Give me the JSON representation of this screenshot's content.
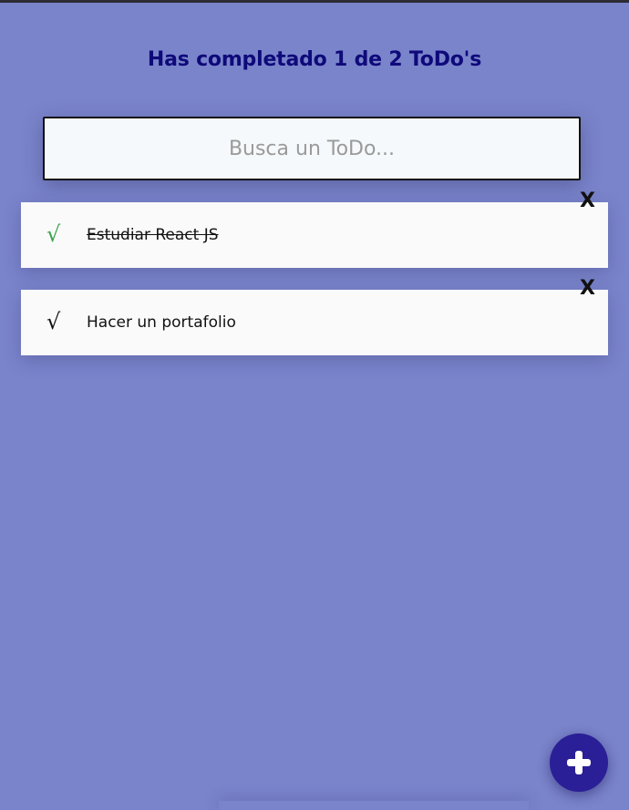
{
  "header": {
    "counter_text": "Has completado 1 de 2 ToDo's"
  },
  "search": {
    "placeholder": "Busca un ToDo...",
    "value": ""
  },
  "todos": [
    {
      "text": "Estudiar React JS",
      "completed": true,
      "check_glyph": "√",
      "delete_label": "X"
    },
    {
      "text": "Hacer un portafolio",
      "completed": false,
      "check_glyph": "√",
      "delete_label": "X"
    }
  ],
  "fab": {
    "icon": "plus-icon"
  },
  "colors": {
    "background": "#7a84cb",
    "title": "#0f0a7a",
    "check_done": "#3aa24a",
    "fab": "#2a1f96"
  }
}
